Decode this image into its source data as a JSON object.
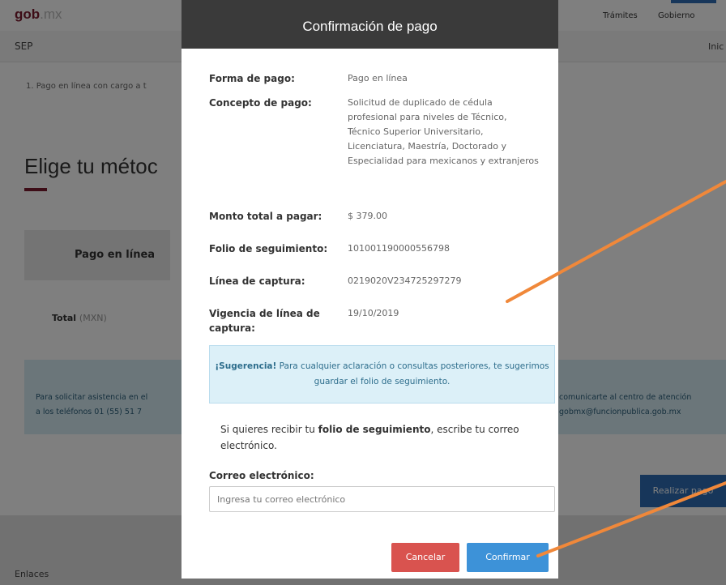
{
  "header": {
    "logo_main": "gob",
    "logo_suffix": ".mx",
    "nav": [
      "Trámites",
      "Gobierno"
    ],
    "sub_title": "SEP",
    "sub_right": "Inic"
  },
  "main": {
    "step": "1. Pago en línea con cargo a t",
    "heading": "Elige tu métoc",
    "payment_tab": "Pago en línea",
    "total_label": "Total",
    "total_unit": "(MXN)",
    "info_left_1": "Para solicitar asistencia en el",
    "info_left_2": "a los teléfonos 01 (55) 51 7",
    "info_right_1": "comunicarte al centro de atención",
    "info_right_2": "gobmx@funcionpublica.gob.mx",
    "pay_button": "Realizar pago"
  },
  "footer": {
    "label": "Enlaces"
  },
  "modal": {
    "title": "Confirmación de pago",
    "rows": [
      {
        "label": "Forma de pago:",
        "value": "Pago en línea"
      },
      {
        "label": "Concepto de pago:",
        "value": "Solicitud de duplicado de cédula profesional para niveles de Técnico, Técnico Superior Universitario, Licenciatura, Maestría, Doctorado y Especialidad para mexicanos y extranjeros"
      },
      {
        "label": "Monto total a pagar:",
        "value": "$ 379.00"
      },
      {
        "label": "Folio de seguimiento:",
        "value": "101001190000556798"
      },
      {
        "label": "Línea de captura:",
        "value": "0219020V234725297279"
      },
      {
        "label": "Vigencia de línea de captura:",
        "value": "19/10/2019"
      }
    ],
    "suggestion_bold": "¡Sugerencia!",
    "suggestion_text": "Para cualquier aclaración o consultas posteriores, te sugerimos guardar el folio de seguimiento.",
    "receive_pre": "Si quieres recibir tu ",
    "receive_bold": "folio de seguimiento",
    "receive_post": ", escribe tu correo electrónico.",
    "email_label": "Correo electrónico:",
    "email_placeholder": "Ingresa tu correo electrónico",
    "cancel_label": "Cancelar",
    "confirm_label": "Confirmar"
  },
  "colors": {
    "brand": "#7a1a2e",
    "modal_header": "#3a3a3a",
    "cancel": "#d9534f",
    "confirm": "#3d92d8",
    "annotation_arrow": "#f0883a"
  }
}
